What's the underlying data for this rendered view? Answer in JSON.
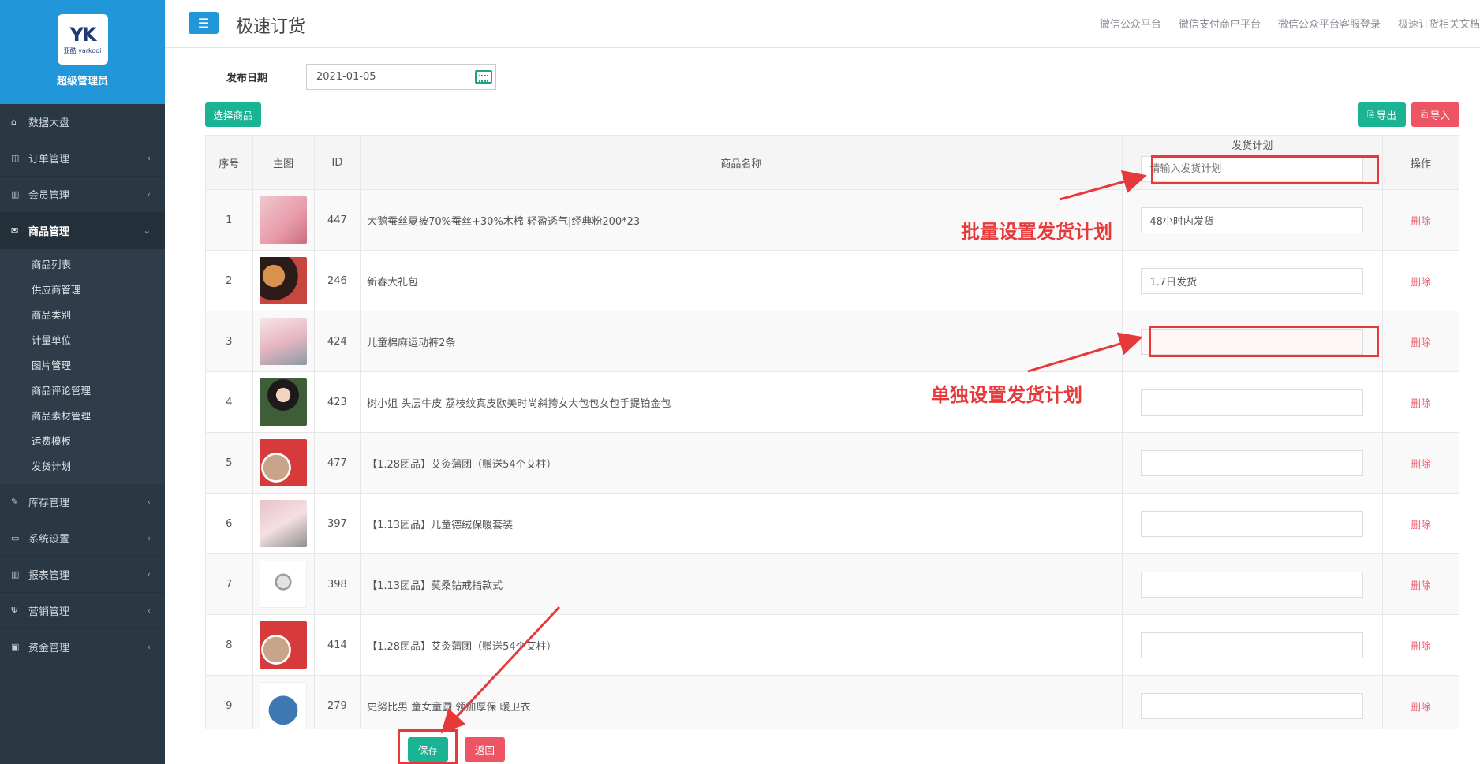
{
  "sidebar": {
    "logo_text": "YK",
    "logo_sub": "亚酷 yarkooi",
    "user_role": "超级管理员",
    "menu": [
      {
        "label": "数据大盘",
        "icon": "home-icon",
        "arrow": ""
      },
      {
        "label": "订单管理",
        "icon": "columns-icon",
        "arrow": "‹"
      },
      {
        "label": "会员管理",
        "icon": "bar-chart-icon",
        "arrow": "‹"
      },
      {
        "label": "商品管理",
        "icon": "envelope-icon",
        "arrow": "⌄"
      },
      {
        "label": "库存管理",
        "icon": "edit-icon",
        "arrow": "‹"
      },
      {
        "label": "系统设置",
        "icon": "desktop-icon",
        "arrow": "‹"
      },
      {
        "label": "报表管理",
        "icon": "bar-chart-icon",
        "arrow": "‹"
      },
      {
        "label": "营销管理",
        "icon": "cutlery-icon",
        "arrow": "‹"
      },
      {
        "label": "资金管理",
        "icon": "money-icon",
        "arrow": "‹"
      }
    ],
    "submenu": [
      "商品列表",
      "供应商管理",
      "商品类别",
      "计量单位",
      "图片管理",
      "商品评论管理",
      "商品素材管理",
      "运费模板",
      "发货计划"
    ]
  },
  "topbar": {
    "menu_icon": "☰",
    "title": "极速订货",
    "links": [
      "微信公众平台",
      "微信支付商户平台",
      "微信公众平台客服登录",
      "极速订货相关文档"
    ]
  },
  "form": {
    "date_label": "发布日期",
    "date_value": "2021-01-05"
  },
  "buttons": {
    "select_goods": "选择商品",
    "export": "导出",
    "import": "导入",
    "save": "保存",
    "back": "返回"
  },
  "table": {
    "headers": {
      "index": "序号",
      "image": "主图",
      "id": "ID",
      "name": "商品名称",
      "plan": "发货计划",
      "action": "操作"
    },
    "batch_placeholder": "请输入发货计划",
    "delete_label": "删除",
    "rows": [
      {
        "index": "1",
        "id": "447",
        "name": "大鹅蚕丝夏被70%蚕丝+30%木棉 轻盈透气|经典粉200*23",
        "plan": "48小时内发货"
      },
      {
        "index": "2",
        "id": "246",
        "name": "新春大礼包",
        "plan": "1.7日发货"
      },
      {
        "index": "3",
        "id": "424",
        "name": "儿童棉麻运动裤2条",
        "plan": ""
      },
      {
        "index": "4",
        "id": "423",
        "name": "树小姐 头层牛皮 荔枝纹真皮欧美时尚斜挎女大包包女包手提铂金包",
        "plan": ""
      },
      {
        "index": "5",
        "id": "477",
        "name": "【1.28团品】艾灸蒲团（赠送54个艾柱）",
        "plan": ""
      },
      {
        "index": "6",
        "id": "397",
        "name": "【1.13团品】儿童德绒保暖套装",
        "plan": ""
      },
      {
        "index": "7",
        "id": "398",
        "name": "【1.13团品】莫桑钻戒指款式",
        "plan": ""
      },
      {
        "index": "8",
        "id": "414",
        "name": "【1.28团品】艾灸蒲团（赠送54个艾柱）",
        "plan": ""
      },
      {
        "index": "9",
        "id": "279",
        "name": "史努比男 童女童圆 领加厚保 暖卫衣",
        "plan": ""
      }
    ]
  },
  "annotations": {
    "batch": "批量设置发货计划",
    "single": "单独设置发货计划"
  },
  "colors": {
    "primary": "#2196d9",
    "success": "#1ab394",
    "danger": "#ed5565",
    "sidebar": "#2a3843",
    "annotation": "#e8393a"
  }
}
